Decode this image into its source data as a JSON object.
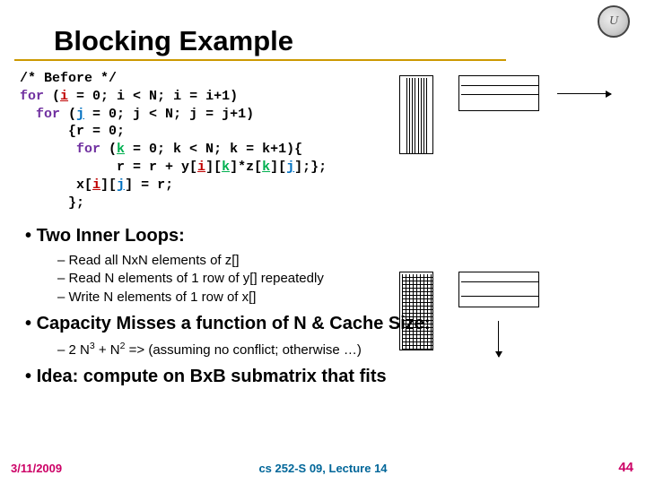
{
  "title": "Blocking Example",
  "code": {
    "l1": "/* Before */",
    "l2a": "for",
    "l2b": " (",
    "l2c": "i",
    "l2d": " = 0; i < N; i = i+1)",
    "l3a": "  for",
    "l3b": " (",
    "l3c": "j",
    "l3d": " = 0; j < N; j = j+1)",
    "l4": "      {r = 0;",
    "l5a": "       for",
    "l5b": " (",
    "l5c": "k",
    "l5d": " = 0; k < N; k = k+1){",
    "l6a": "            r = r + y[",
    "l6b": "i",
    "l6c": "][",
    "l6d": "k",
    "l6e": "]*z[",
    "l6f": "k",
    "l6g": "][",
    "l6h": "j",
    "l6i": "];};",
    "l7a": "       x[",
    "l7b": "i",
    "l7c": "][",
    "l7d": "j",
    "l7e": "] = r;",
    "l8": "      };"
  },
  "b1": "Two Inner Loops:",
  "s1": "Read all NxN elements of z[]",
  "s2": "Read N elements of 1 row of y[] repeatedly",
  "s3": "Write N elements of 1 row  of x[]",
  "b2": "Capacity Misses a function of N & Cache Size:",
  "s4a": "2 N",
  "s4b": " + N",
  "s4c": " => (assuming no conflict; otherwise …)",
  "b3": "Idea: compute on BxB submatrix that fits",
  "footer": {
    "date": "3/11/2009",
    "course": "cs 252-S 09, Lecture 14",
    "page": "44"
  }
}
